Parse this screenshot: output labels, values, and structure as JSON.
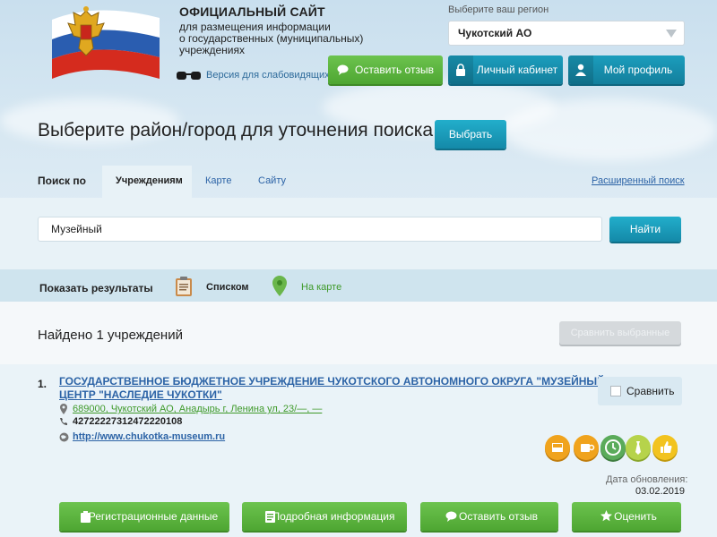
{
  "header": {
    "title": "ОФИЦИАЛЬНЫЙ САЙТ",
    "subtitle_lines": [
      "для размещения информации",
      "о государственных (муниципальных)",
      "учреждениях"
    ],
    "low_vision_label": "Версия для слабовидящих",
    "region_label": "Выберите ваш регион",
    "region_value": "Чукотский АО",
    "buttons": {
      "feedback": "Оставить отзыв",
      "cabinet": "Личный кабинет",
      "profile": "Мой профиль"
    }
  },
  "district": {
    "heading": "Выберите район/город для уточнения поиска",
    "choose_button": "Выбрать"
  },
  "search": {
    "by_label": "Поиск по",
    "tabs": [
      "Учреждениям",
      "Карте",
      "Сайту"
    ],
    "advanced_link": "Расширенный поиск",
    "query": "Музейный",
    "find_button": "Найти"
  },
  "results": {
    "show_label": "Показать результаты",
    "list_label": "Списком",
    "map_label": "На карте",
    "found_text": "Найдено 1 учреждений",
    "compare_selected": "Сравнить выбранные"
  },
  "item": {
    "number": "1.",
    "name_lines": [
      "ГОСУДАРСТВЕННОЕ БЮДЖЕТНОЕ УЧРЕЖДЕНИЕ ЧУКОТСКОГО АВТОНОМНОГО ОКРУГА \"МУЗЕЙНЫЙ",
      "ЦЕНТР \"НАСЛЕДИЕ ЧУКОТКИ\""
    ],
    "address": "689000, Чукотский АО, Анадырь г, Ленина ул, 23/—, —",
    "phone": "42722227312472220108",
    "website": "http://www.chukotka-museum.ru",
    "compare_label": "Сравнить",
    "update_label": "Дата обновления:",
    "update_date": "03.02.2019",
    "actions": [
      "Регистрационные данные",
      "Подробная информация",
      "Оставить отзыв",
      "Оценить"
    ]
  },
  "colors": {
    "green": "#5cb83e",
    "teal": "#1a9dbd",
    "link": "#2c63a6"
  }
}
